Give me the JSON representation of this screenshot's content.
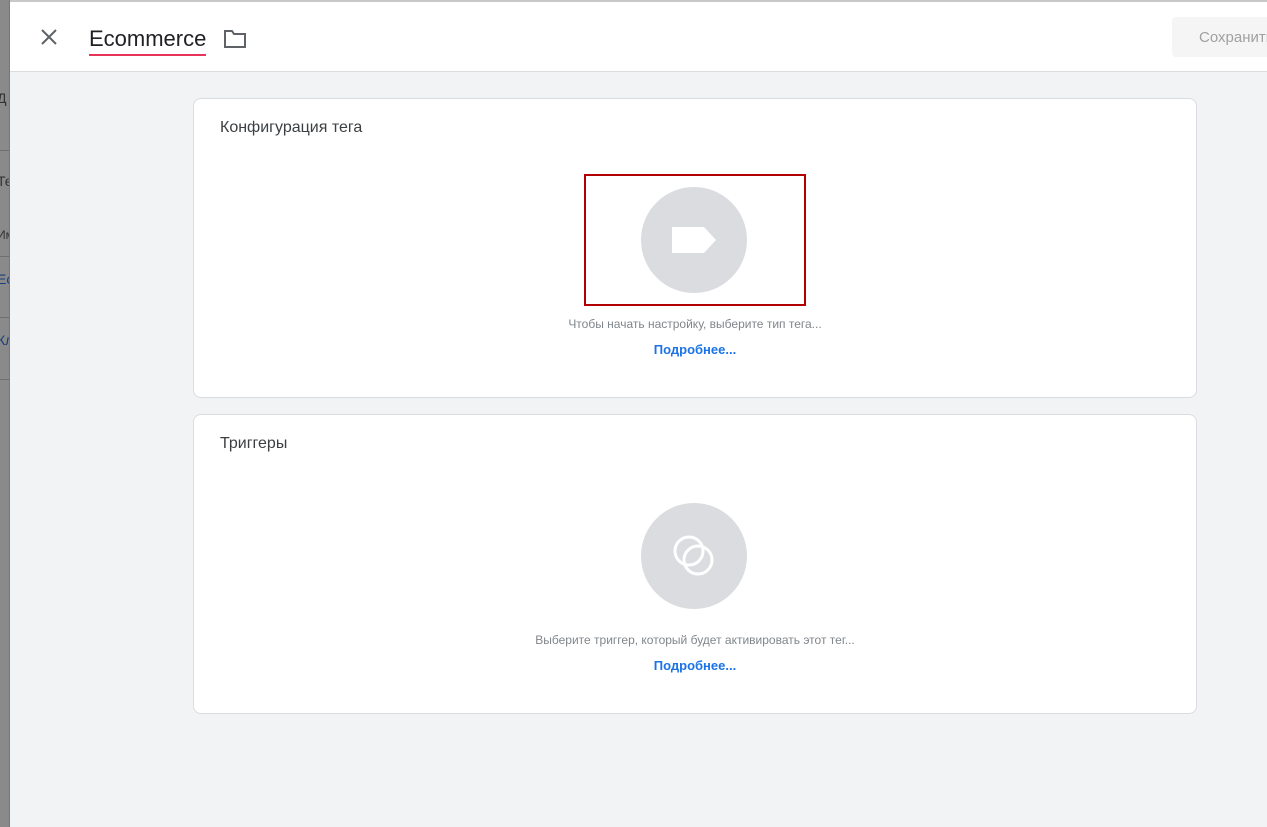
{
  "header": {
    "title": "Ecommerce",
    "save_label": "Сохранить"
  },
  "background_fragments": [
    "Д",
    "Те",
    "Им",
    "Ec",
    "Кл"
  ],
  "tag_config": {
    "title": "Конфигурация тега",
    "icon": "tag-icon",
    "hint": "Чтобы начать настройку, выберите тип тега...",
    "more": "Подробнее..."
  },
  "triggers": {
    "title": "Триггеры",
    "icon": "trigger-icon",
    "hint": "Выберите триггер, который будет активировать этот тег...",
    "more": "Подробнее..."
  },
  "colors": {
    "accent": "#1a73e8",
    "underline": "#e8345a",
    "selection": "#b00000"
  }
}
